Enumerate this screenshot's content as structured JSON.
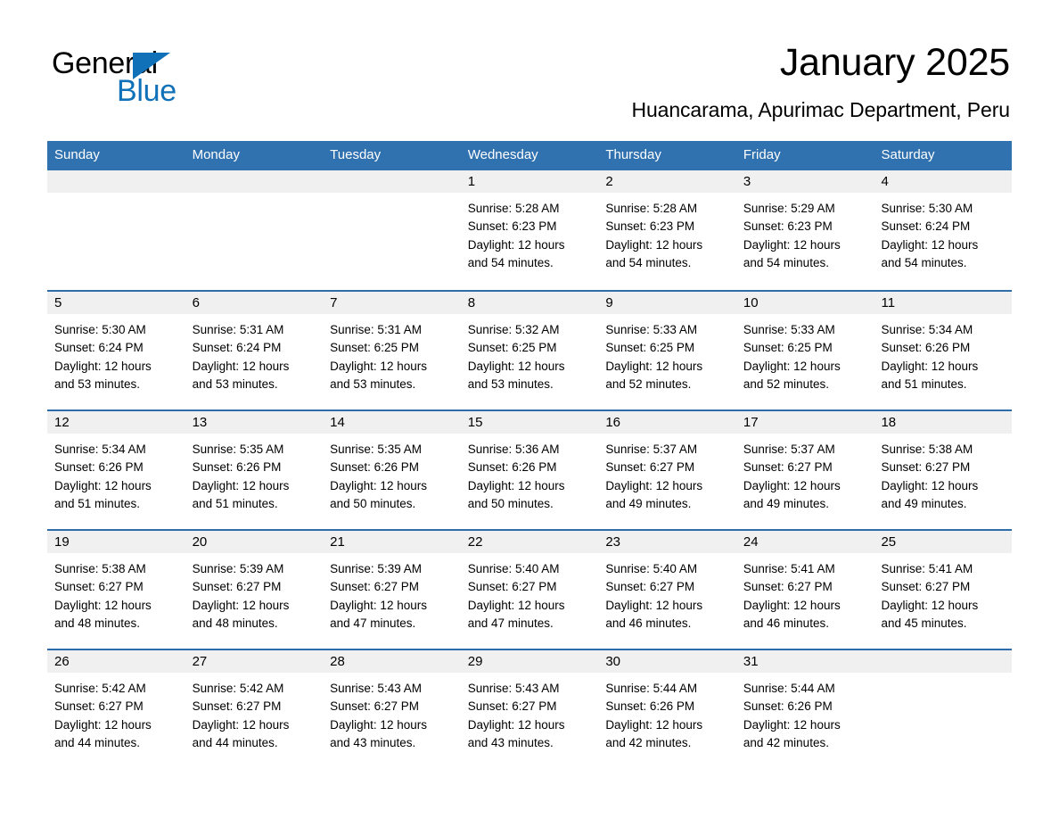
{
  "logo": {
    "word_one": "General",
    "word_two": "Blue",
    "accent_color": "#1071B8"
  },
  "header": {
    "title": "January 2025",
    "subtitle": "Huancarama, Apurimac Department, Peru"
  },
  "theme": {
    "header_blue": "#3071B0",
    "row_divider_blue": "#2E6DAC",
    "day_band_gray": "#F0F0F0",
    "background": "#ffffff"
  },
  "weekdays": [
    "Sunday",
    "Monday",
    "Tuesday",
    "Wednesday",
    "Thursday",
    "Friday",
    "Saturday"
  ],
  "labels": {
    "sunrise_prefix": "Sunrise:",
    "sunset_prefix": "Sunset:",
    "daylight_prefix": "Daylight:"
  },
  "weeks": [
    [
      {
        "day": "",
        "line1": "",
        "line2": "",
        "line3": "",
        "line4": ""
      },
      {
        "day": "",
        "line1": "",
        "line2": "",
        "line3": "",
        "line4": ""
      },
      {
        "day": "",
        "line1": "",
        "line2": "",
        "line3": "",
        "line4": ""
      },
      {
        "day": "1",
        "line1": "Sunrise: 5:28 AM",
        "line2": "Sunset: 6:23 PM",
        "line3": "Daylight: 12 hours",
        "line4": "and 54 minutes."
      },
      {
        "day": "2",
        "line1": "Sunrise: 5:28 AM",
        "line2": "Sunset: 6:23 PM",
        "line3": "Daylight: 12 hours",
        "line4": "and 54 minutes."
      },
      {
        "day": "3",
        "line1": "Sunrise: 5:29 AM",
        "line2": "Sunset: 6:23 PM",
        "line3": "Daylight: 12 hours",
        "line4": "and 54 minutes."
      },
      {
        "day": "4",
        "line1": "Sunrise: 5:30 AM",
        "line2": "Sunset: 6:24 PM",
        "line3": "Daylight: 12 hours",
        "line4": "and 54 minutes."
      }
    ],
    [
      {
        "day": "5",
        "line1": "Sunrise: 5:30 AM",
        "line2": "Sunset: 6:24 PM",
        "line3": "Daylight: 12 hours",
        "line4": "and 53 minutes."
      },
      {
        "day": "6",
        "line1": "Sunrise: 5:31 AM",
        "line2": "Sunset: 6:24 PM",
        "line3": "Daylight: 12 hours",
        "line4": "and 53 minutes."
      },
      {
        "day": "7",
        "line1": "Sunrise: 5:31 AM",
        "line2": "Sunset: 6:25 PM",
        "line3": "Daylight: 12 hours",
        "line4": "and 53 minutes."
      },
      {
        "day": "8",
        "line1": "Sunrise: 5:32 AM",
        "line2": "Sunset: 6:25 PM",
        "line3": "Daylight: 12 hours",
        "line4": "and 53 minutes."
      },
      {
        "day": "9",
        "line1": "Sunrise: 5:33 AM",
        "line2": "Sunset: 6:25 PM",
        "line3": "Daylight: 12 hours",
        "line4": "and 52 minutes."
      },
      {
        "day": "10",
        "line1": "Sunrise: 5:33 AM",
        "line2": "Sunset: 6:25 PM",
        "line3": "Daylight: 12 hours",
        "line4": "and 52 minutes."
      },
      {
        "day": "11",
        "line1": "Sunrise: 5:34 AM",
        "line2": "Sunset: 6:26 PM",
        "line3": "Daylight: 12 hours",
        "line4": "and 51 minutes."
      }
    ],
    [
      {
        "day": "12",
        "line1": "Sunrise: 5:34 AM",
        "line2": "Sunset: 6:26 PM",
        "line3": "Daylight: 12 hours",
        "line4": "and 51 minutes."
      },
      {
        "day": "13",
        "line1": "Sunrise: 5:35 AM",
        "line2": "Sunset: 6:26 PM",
        "line3": "Daylight: 12 hours",
        "line4": "and 51 minutes."
      },
      {
        "day": "14",
        "line1": "Sunrise: 5:35 AM",
        "line2": "Sunset: 6:26 PM",
        "line3": "Daylight: 12 hours",
        "line4": "and 50 minutes."
      },
      {
        "day": "15",
        "line1": "Sunrise: 5:36 AM",
        "line2": "Sunset: 6:26 PM",
        "line3": "Daylight: 12 hours",
        "line4": "and 50 minutes."
      },
      {
        "day": "16",
        "line1": "Sunrise: 5:37 AM",
        "line2": "Sunset: 6:27 PM",
        "line3": "Daylight: 12 hours",
        "line4": "and 49 minutes."
      },
      {
        "day": "17",
        "line1": "Sunrise: 5:37 AM",
        "line2": "Sunset: 6:27 PM",
        "line3": "Daylight: 12 hours",
        "line4": "and 49 minutes."
      },
      {
        "day": "18",
        "line1": "Sunrise: 5:38 AM",
        "line2": "Sunset: 6:27 PM",
        "line3": "Daylight: 12 hours",
        "line4": "and 49 minutes."
      }
    ],
    [
      {
        "day": "19",
        "line1": "Sunrise: 5:38 AM",
        "line2": "Sunset: 6:27 PM",
        "line3": "Daylight: 12 hours",
        "line4": "and 48 minutes."
      },
      {
        "day": "20",
        "line1": "Sunrise: 5:39 AM",
        "line2": "Sunset: 6:27 PM",
        "line3": "Daylight: 12 hours",
        "line4": "and 48 minutes."
      },
      {
        "day": "21",
        "line1": "Sunrise: 5:39 AM",
        "line2": "Sunset: 6:27 PM",
        "line3": "Daylight: 12 hours",
        "line4": "and 47 minutes."
      },
      {
        "day": "22",
        "line1": "Sunrise: 5:40 AM",
        "line2": "Sunset: 6:27 PM",
        "line3": "Daylight: 12 hours",
        "line4": "and 47 minutes."
      },
      {
        "day": "23",
        "line1": "Sunrise: 5:40 AM",
        "line2": "Sunset: 6:27 PM",
        "line3": "Daylight: 12 hours",
        "line4": "and 46 minutes."
      },
      {
        "day": "24",
        "line1": "Sunrise: 5:41 AM",
        "line2": "Sunset: 6:27 PM",
        "line3": "Daylight: 12 hours",
        "line4": "and 46 minutes."
      },
      {
        "day": "25",
        "line1": "Sunrise: 5:41 AM",
        "line2": "Sunset: 6:27 PM",
        "line3": "Daylight: 12 hours",
        "line4": "and 45 minutes."
      }
    ],
    [
      {
        "day": "26",
        "line1": "Sunrise: 5:42 AM",
        "line2": "Sunset: 6:27 PM",
        "line3": "Daylight: 12 hours",
        "line4": "and 44 minutes."
      },
      {
        "day": "27",
        "line1": "Sunrise: 5:42 AM",
        "line2": "Sunset: 6:27 PM",
        "line3": "Daylight: 12 hours",
        "line4": "and 44 minutes."
      },
      {
        "day": "28",
        "line1": "Sunrise: 5:43 AM",
        "line2": "Sunset: 6:27 PM",
        "line3": "Daylight: 12 hours",
        "line4": "and 43 minutes."
      },
      {
        "day": "29",
        "line1": "Sunrise: 5:43 AM",
        "line2": "Sunset: 6:27 PM",
        "line3": "Daylight: 12 hours",
        "line4": "and 43 minutes."
      },
      {
        "day": "30",
        "line1": "Sunrise: 5:44 AM",
        "line2": "Sunset: 6:26 PM",
        "line3": "Daylight: 12 hours",
        "line4": "and 42 minutes."
      },
      {
        "day": "31",
        "line1": "Sunrise: 5:44 AM",
        "line2": "Sunset: 6:26 PM",
        "line3": "Daylight: 12 hours",
        "line4": "and 42 minutes."
      },
      {
        "day": "",
        "line1": "",
        "line2": "",
        "line3": "",
        "line4": ""
      }
    ]
  ]
}
